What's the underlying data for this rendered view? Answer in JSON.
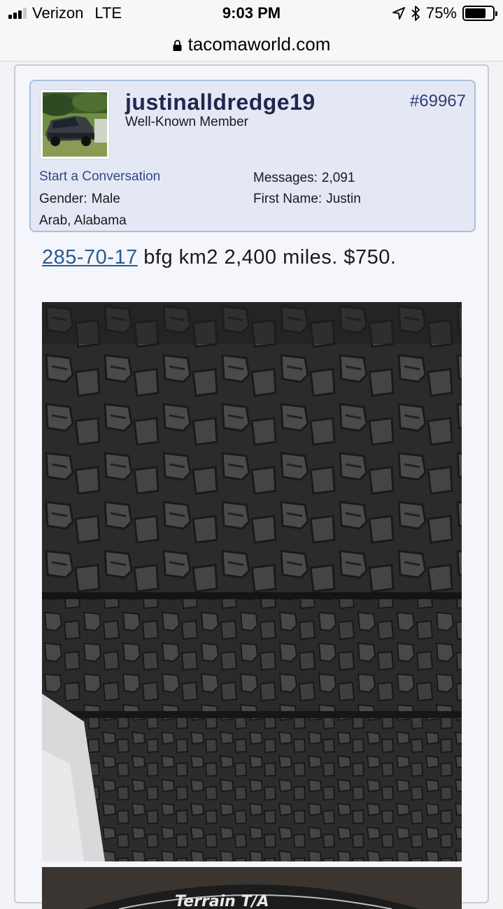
{
  "status_bar": {
    "carrier": "Verizon",
    "network": "LTE",
    "time": "9:03 PM",
    "battery": "75%",
    "battery_level": 0.75
  },
  "browser": {
    "url": "tacomaworld.com"
  },
  "post": {
    "user": {
      "username": "justinalldredge19",
      "title": "Well-Known Member",
      "start_conversation": "Start a Conversation",
      "gender_label": "Gender:",
      "gender": "Male",
      "location": "Arab, Alabama",
      "messages_label": "Messages:",
      "messages": "2,091",
      "first_name_label": "First Name:",
      "first_name": "Justin"
    },
    "post_number": "#69967",
    "message": {
      "link_text": "285-70-17",
      "text": " bfg km2 2,400 miles. $750."
    },
    "photo2_caption": "Terrain T/A"
  },
  "colors": {
    "username": "#23264d",
    "link": "#2a5a8f",
    "userinfo_bg": "#e4e8f5",
    "userinfo_border": "#a9c0de"
  }
}
